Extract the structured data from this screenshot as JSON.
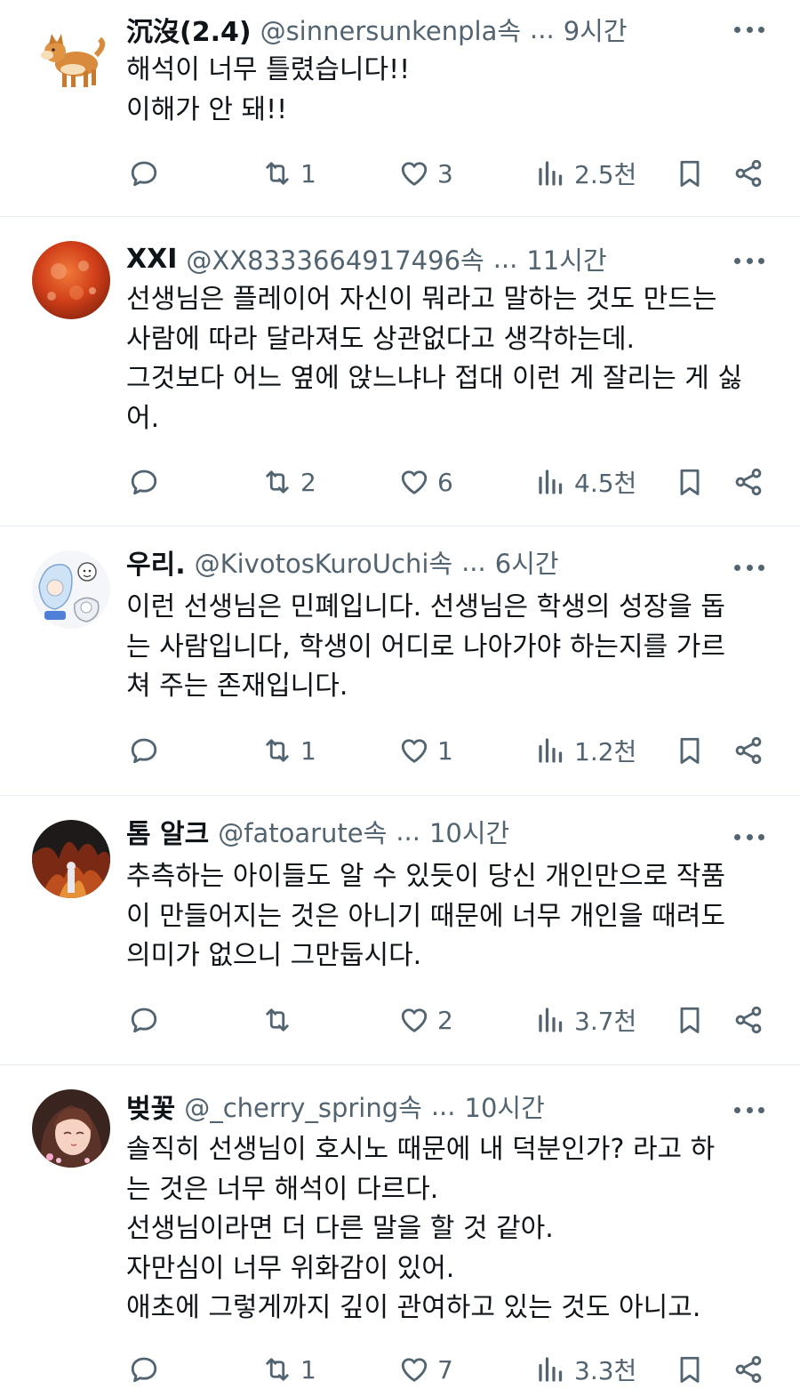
{
  "posts": [
    {
      "name": "沉沒(2.4)",
      "handle": "@sinnersunkenpla속",
      "ellipsis": "...",
      "time": "9시간",
      "lines": [
        "해석이 너무 틀렸습니다!!",
        "이해가 안 돼!!"
      ],
      "reply_count": "",
      "retweet_count": "1",
      "like_count": "3",
      "view_count": "2.5천",
      "avatar_icon": "shiba-dog-avatar"
    },
    {
      "name": "XXI",
      "handle": "@XX8333664917496속",
      "ellipsis": "...",
      "time": "11시간",
      "lines": [
        "선생님은 플레이어 자신이 뭐라고 말하는 것도 만드는",
        "사람에 따라 달라져도 상관없다고 생각하는데.",
        "그것보다 어느 옆에 앉느냐나 접대 이런 게 잘리는 게 싫",
        "어."
      ],
      "reply_count": "",
      "retweet_count": "2",
      "like_count": "6",
      "view_count": "4.5천",
      "avatar_icon": "red-orb-avatar"
    },
    {
      "name": "우리.",
      "handle": "@KivotosKuroUchi속",
      "ellipsis": "...",
      "time": "6시간",
      "lines": [
        "이런 선생님은 민폐입니다. 선생님은 학생의 성장을 돕",
        "는 사람입니다, 학생이 어디로 나아가야 하는지를 가르",
        "쳐 주는 존재입니다."
      ],
      "reply_count": "",
      "retweet_count": "1",
      "like_count": "1",
      "view_count": "1.2천",
      "avatar_icon": "anime-sketch-avatar"
    },
    {
      "name": "톰 알크",
      "handle": "@fatoarute속",
      "ellipsis": "...",
      "time": "10시간",
      "lines": [
        "추측하는 아이들도 알 수 있듯이 당신 개인만으로 작품",
        "이 만들어지는 것은 아니기 때문에 너무 개인을 때려도",
        "의미가 없으니 그만둡시다."
      ],
      "reply_count": "",
      "retweet_count": "",
      "like_count": "2",
      "view_count": "3.7천",
      "avatar_icon": "dark-fire-avatar"
    },
    {
      "name": "벚꽃",
      "handle": "@_cherry_spring속",
      "ellipsis": "...",
      "time": "10시간",
      "lines": [
        "솔직히 선생님이 호시노 때문에 내 덕분인가? 라고 하",
        "는 것은 너무 해석이 다르다.",
        "선생님이라면 더 다른 말을 할 것 같아.",
        "자만심이 너무 위화감이 있어.",
        "애초에 그렇게까지 깊이 관여하고 있는 것도 아니고."
      ],
      "reply_count": "",
      "retweet_count": "1",
      "like_count": "7",
      "view_count": "3.3천",
      "avatar_icon": "anime-girl-avatar"
    }
  ],
  "colors": {
    "text": "#0f1419",
    "muted": "#536471",
    "divider": "#e6ecf0"
  }
}
